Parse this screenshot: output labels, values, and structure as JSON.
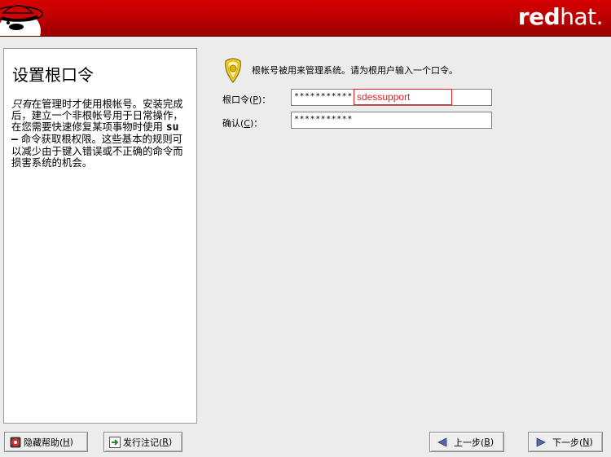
{
  "header": {
    "brand_bold": "red",
    "brand_light": "hat."
  },
  "help": {
    "title": "设置根口令",
    "body_italic": "只有",
    "body_p1": "在管理时才使用根帐号。安装完成后，建立一个非根帐号用于日常操作，在您需要快速修复某项事物时使用 ",
    "body_cmd": "su –",
    "body_p2": " 命令获取根权限。这些基本的规则可以减少由于键入错误或不正确的命令而损害系统的机会。"
  },
  "main": {
    "intro": "根帐号被用来管理系统。请为根用户输入一个口令。",
    "root_password": {
      "label": "根口令(",
      "key": "P",
      "suffix": ")：",
      "value": "***********"
    },
    "confirm": {
      "label": "确认(",
      "key": "C",
      "suffix": ")：",
      "value": "***********"
    },
    "overlay_text": "sdessupport"
  },
  "buttons": {
    "hide_help": {
      "label": "隐藏帮助(",
      "key": "H",
      "suffix": ")"
    },
    "release_notes": {
      "label": "发行注记(",
      "key": "R",
      "suffix": ")"
    },
    "back": {
      "label": "上一步(",
      "key": "B",
      "suffix": ")"
    },
    "next": {
      "label": "下一步(",
      "key": "N",
      "suffix": ")"
    }
  },
  "colors": {
    "header_red": "#c80000",
    "annotation_red": "#e02020"
  }
}
